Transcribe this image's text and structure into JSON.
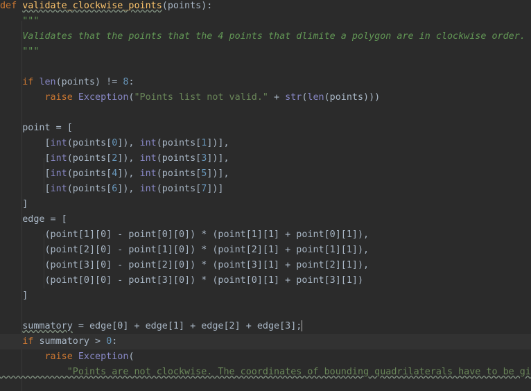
{
  "code": {
    "line1": {
      "kw": "def",
      "fn": "validate_clockwise_points",
      "rest": "(points):"
    },
    "line2": {
      "doc": "    \"\"\""
    },
    "line3": {
      "doc": "    Validates that the points that the 4 points that dlimite a polygon are in clockwise order."
    },
    "line4": {
      "doc": "    \"\"\""
    },
    "line6": {
      "kw": "    if ",
      "bi": "len",
      "rest": "(points) != ",
      "num": "8",
      "tail": ":"
    },
    "line7": {
      "kw": "        raise ",
      "bi": "Exception",
      "p1": "(",
      "str": "\"Points list not valid.\"",
      "p2": " + ",
      "bi2": "str",
      "p3": "(",
      "bi3": "len",
      "p4": "(points)))"
    },
    "line9": {
      "text": "    point = ["
    },
    "line10": {
      "a": "        [",
      "b": "int",
      "c": "(points[",
      "d": "0",
      "e": "]), ",
      "f": "int",
      "g": "(points[",
      "h": "1",
      "i": "])],"
    },
    "line11": {
      "a": "        [",
      "b": "int",
      "c": "(points[",
      "d": "2",
      "e": "]), ",
      "f": "int",
      "g": "(points[",
      "h": "3",
      "i": "])],"
    },
    "line12": {
      "a": "        [",
      "b": "int",
      "c": "(points[",
      "d": "4",
      "e": "]), ",
      "f": "int",
      "g": "(points[",
      "h": "5",
      "i": "])],"
    },
    "line13": {
      "a": "        [",
      "b": "int",
      "c": "(points[",
      "d": "6",
      "e": "]), ",
      "f": "int",
      "g": "(points[",
      "h": "7",
      "i": "])]"
    },
    "line14": {
      "text": "    ]"
    },
    "line15": {
      "text": "    edge = ["
    },
    "line16": {
      "text": "        (point[1][0] - point[0][0]) * (point[1][1] + point[0][1]),"
    },
    "line17": {
      "text": "        (point[2][0] - point[1][0]) * (point[2][1] + point[1][1]),"
    },
    "line18": {
      "text": "        (point[3][0] - point[2][0]) * (point[3][1] + point[2][1]),"
    },
    "line19": {
      "text": "        (point[0][0] - point[3][0]) * (point[0][1] + point[3][1])"
    },
    "line20": {
      "text": "    ]"
    },
    "line22": {
      "var": "summatory",
      "rest": " = edge[0] + edge[1] + edge[2] + edge[3];"
    },
    "line23": {
      "kw": "    if ",
      "rest": "summatory > ",
      "num": "0",
      "tail": ":"
    },
    "line24": {
      "kw": "        raise ",
      "bi": "Exception",
      "rest": "("
    },
    "line25": {
      "str": "            \"Points are not clockwise. The coordinates of bounding quadrilaterals have to be giv"
    }
  },
  "colors": {
    "background": "#2b2b2b",
    "keyword": "#cc7832",
    "function": "#ffc66d",
    "number": "#6897bb",
    "string": "#6a8759",
    "builtin": "#8888c6",
    "text": "#a9b7c6"
  }
}
